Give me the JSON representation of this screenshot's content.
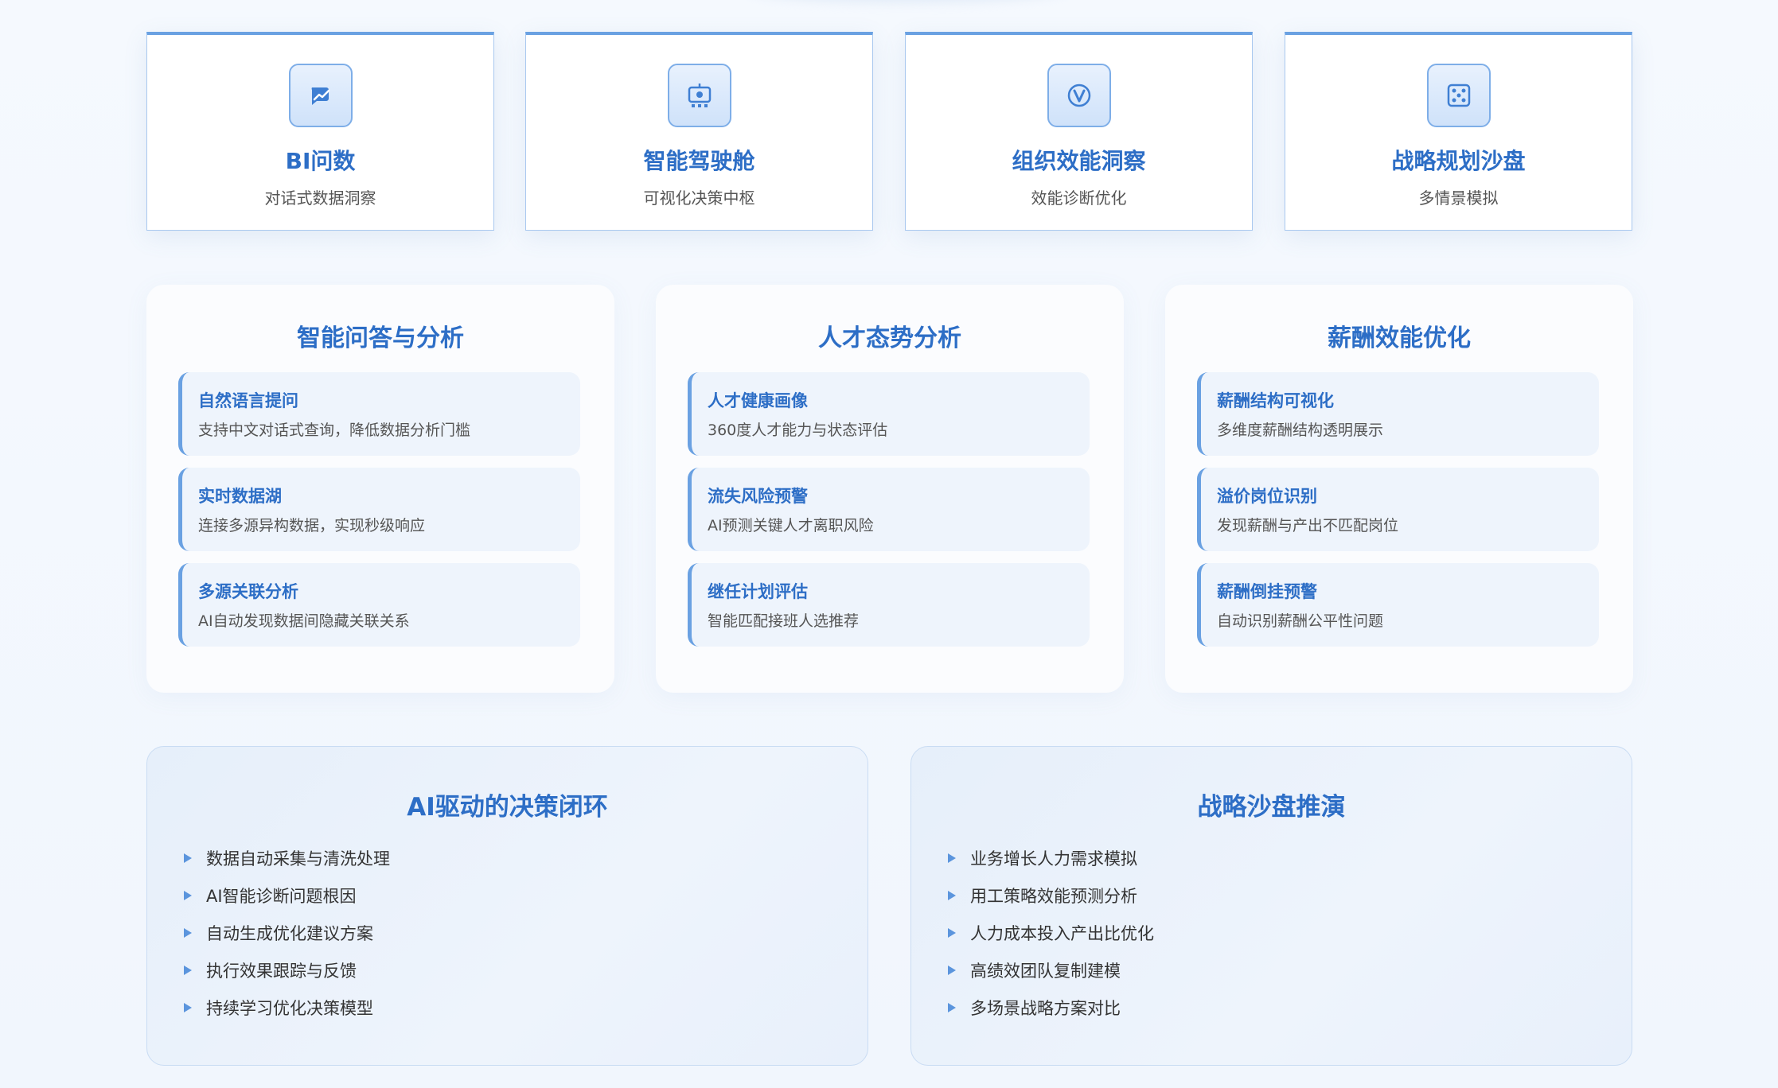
{
  "features": [
    {
      "icon": "chart-bubble-icon",
      "title": "BI问数",
      "subtitle": "对话式数据洞察"
    },
    {
      "icon": "dashboard-screen-icon",
      "title": "智能驾驶舱",
      "subtitle": "可视化决策中枢"
    },
    {
      "icon": "v-circle-icon",
      "title": "组织效能洞察",
      "subtitle": "效能诊断优化"
    },
    {
      "icon": "dice-grid-icon",
      "title": "战略规划沙盘",
      "subtitle": "多情景模拟"
    }
  ],
  "panels": [
    {
      "title": "智能问答与分析",
      "items": [
        {
          "title": "自然语言提问",
          "desc": "支持中文对话式查询，降低数据分析门槛"
        },
        {
          "title": "实时数据湖",
          "desc": "连接多源异构数据，实现秒级响应"
        },
        {
          "title": "多源关联分析",
          "desc": "AI自动发现数据间隐藏关联关系"
        }
      ]
    },
    {
      "title": "人才态势分析",
      "items": [
        {
          "title": "人才健康画像",
          "desc": "360度人才能力与状态评估"
        },
        {
          "title": "流失风险预警",
          "desc": "AI预测关键人才离职风险"
        },
        {
          "title": "继任计划评估",
          "desc": "智能匹配接班人选推荐"
        }
      ]
    },
    {
      "title": "薪酬效能优化",
      "items": [
        {
          "title": "薪酬结构可视化",
          "desc": "多维度薪酬结构透明展示"
        },
        {
          "title": "溢价岗位识别",
          "desc": "发现薪酬与产出不匹配岗位"
        },
        {
          "title": "薪酬倒挂预警",
          "desc": "自动识别薪酬公平性问题"
        }
      ]
    }
  ],
  "boxes": [
    {
      "title": "AI驱动的决策闭环",
      "items": [
        "数据自动采集与清洗处理",
        "AI智能诊断问题根因",
        "自动生成优化建议方案",
        "执行效果跟踪与反馈",
        "持续学习优化决策模型"
      ]
    },
    {
      "title": "战略沙盘推演",
      "items": [
        "业务增长人力需求模拟",
        "用工策略效能预测分析",
        "人力成本投入产出比优化",
        "高绩效团队复制建模",
        "多场景战略方案对比"
      ]
    }
  ],
  "colors": {
    "accent": "#2d6ec6",
    "accent_light": "#6aa1e2",
    "item_bg": "#eef4fc"
  }
}
